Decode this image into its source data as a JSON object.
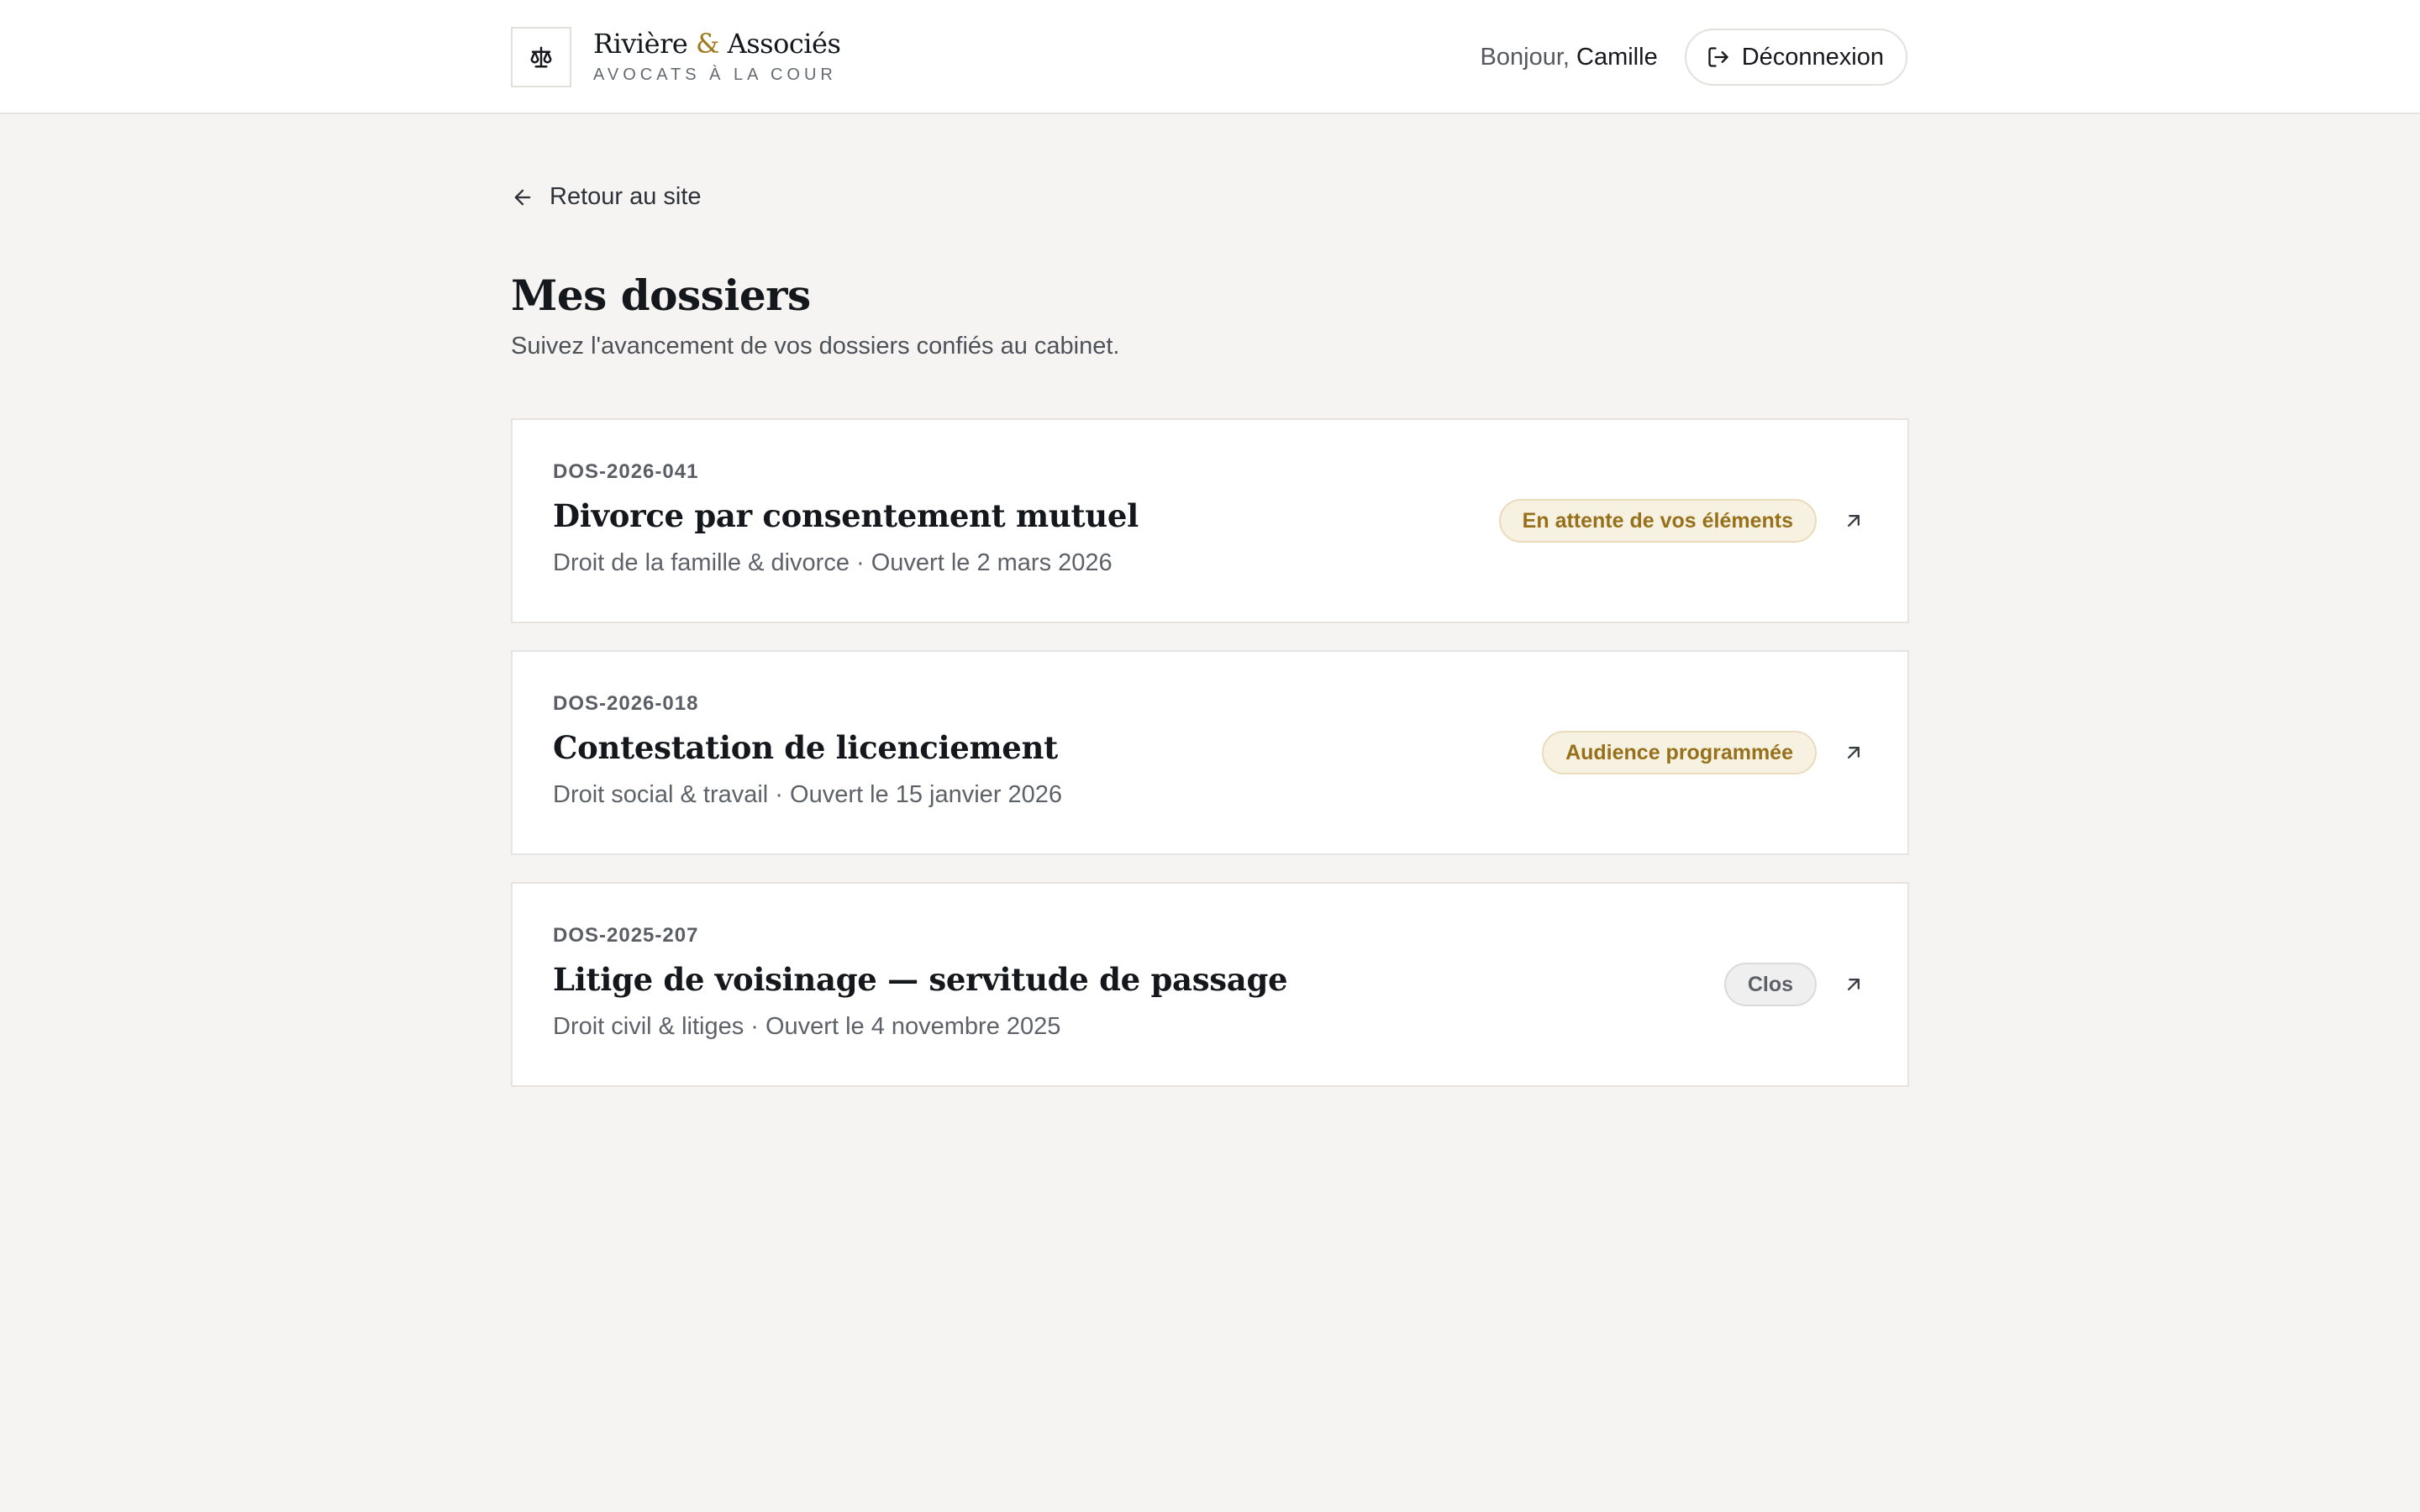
{
  "header": {
    "brand_name_part1": "Rivière",
    "brand_amp": "&",
    "brand_name_part2": "Associés",
    "brand_subtitle": "AVOCATS À LA COUR",
    "greeting_prefix": "Bonjour,",
    "user_name": "Camille",
    "logout_label": "Déconnexion"
  },
  "nav": {
    "back_label": "Retour au site"
  },
  "page": {
    "title": "Mes dossiers",
    "subtitle": "Suivez l'avancement de vos dossiers confiés au cabinet."
  },
  "dossiers": [
    {
      "ref": "DOS-2026-041",
      "title": "Divorce par consentement mutuel",
      "meta": "Droit de la famille & divorce · Ouvert le 2 mars 2026",
      "status": "En attente de vos éléments",
      "status_color": "#96701a"
    },
    {
      "ref": "DOS-2026-018",
      "title": "Contestation de licenciement",
      "meta": "Droit social & travail · Ouvert le 15 janvier 2026",
      "status": "Audience programmée",
      "status_color": "#96701a"
    },
    {
      "ref": "DOS-2025-207",
      "title": "Litige de voisinage — servitude de passage",
      "meta": "Droit civil & litiges · Ouvert le 4 novembre 2025",
      "status": "Clos",
      "status_color": "#5d6167"
    }
  ],
  "icons": {
    "logo": "scales-icon",
    "logout": "logout-icon",
    "back": "arrow-left-icon",
    "open": "arrow-up-right-icon"
  },
  "colors": {
    "accent": "#a07a1e",
    "background": "#f5f4f2"
  }
}
